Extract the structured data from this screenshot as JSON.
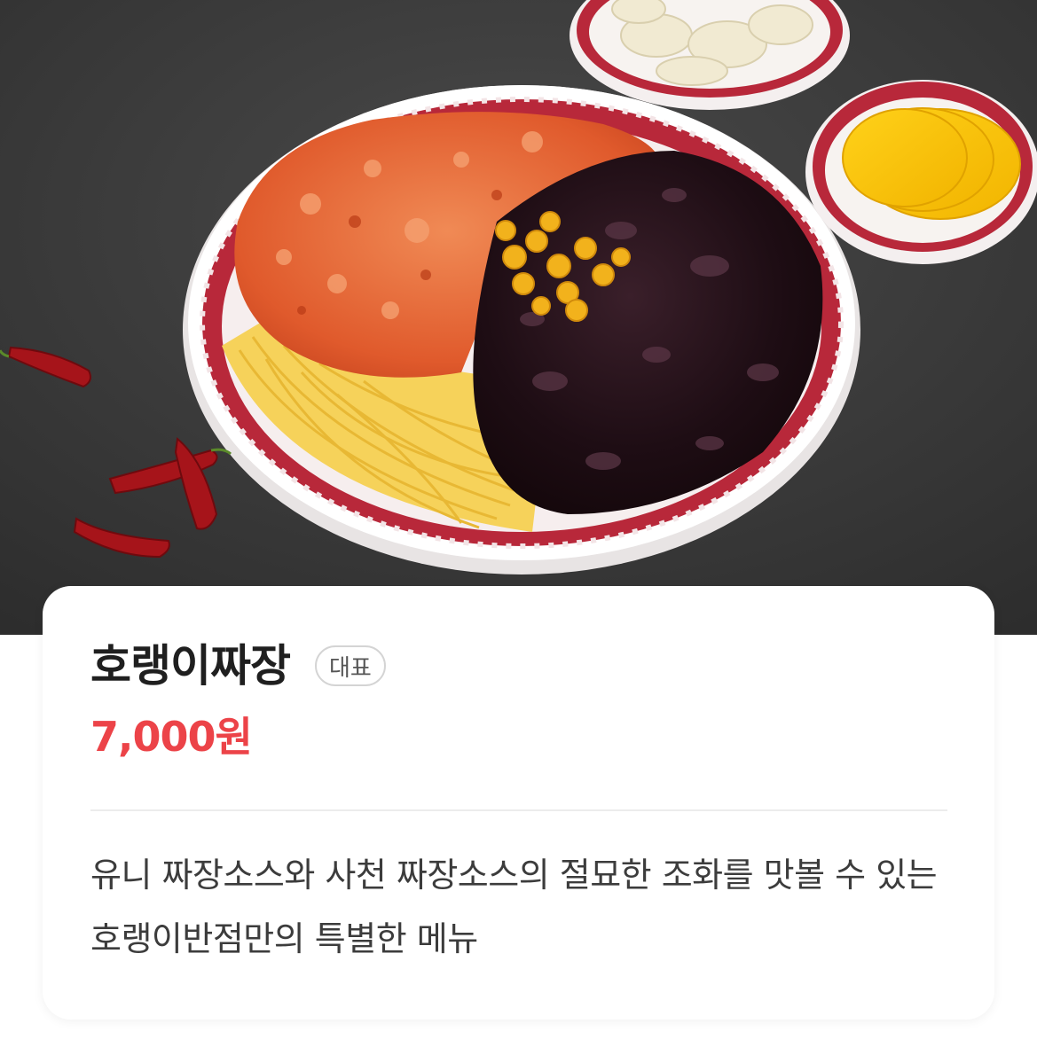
{
  "menu": {
    "name": "호랭이짜장",
    "badge": "대표",
    "price": "7,000원",
    "description": "유니 짜장소스와 사천 짜장소스의 절묘한 조화를 맛볼 수 있는 호랭이반점만의 특별한 메뉴"
  },
  "colors": {
    "price": "#ec4348",
    "background_table": "#3a3a3a"
  }
}
